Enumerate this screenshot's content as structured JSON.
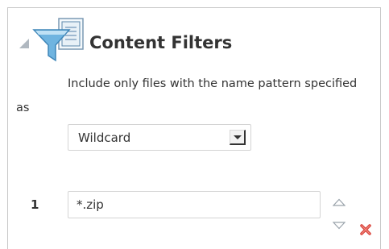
{
  "section": {
    "title": "Content Filters",
    "description": "Include only files with the name pattern specified as"
  },
  "pattern_type": {
    "selected": "Wildcard"
  },
  "filters": [
    {
      "index": "1",
      "value": "*.zip"
    }
  ],
  "icons": {
    "disclosure": "collapse-triangle-icon",
    "section": "filter-funnel-icon",
    "move_up": "move-up-icon",
    "move_down": "move-down-icon",
    "delete": "delete-x-icon"
  },
  "colors": {
    "accent": "#5aa0cc",
    "delete": "#d9453d",
    "text": "#333333"
  }
}
